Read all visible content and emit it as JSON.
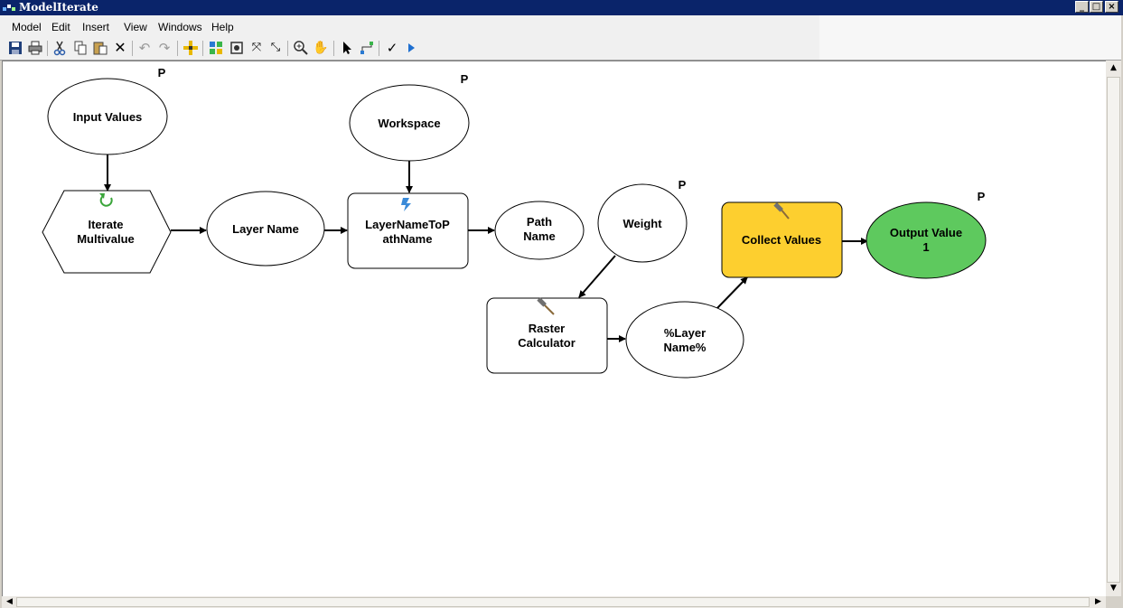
{
  "window": {
    "title": "ModelIterate",
    "controls": {
      "minimize": "_",
      "maximize": "□",
      "close": "×"
    }
  },
  "menu": [
    "Model",
    "Edit",
    "Insert",
    "View",
    "Windows",
    "Help"
  ],
  "toolbar": {
    "buttons": [
      "save-icon",
      "print-icon",
      "cut-icon",
      "copy-icon",
      "paste-icon",
      "delete-icon",
      "undo-icon",
      "redo-icon",
      "add-data-icon",
      "auto-layout-icon",
      "full-extent-icon",
      "zoom-in-fixed-icon",
      "zoom-out-fixed-icon",
      "zoom-icon",
      "pan-icon",
      "select-icon",
      "connect-icon",
      "validate-icon",
      "run-icon"
    ]
  },
  "colors": {
    "collect_values_fill": "#fdcf2f",
    "output_value_fill": "#5ec95e",
    "titlebar": "#0a246a",
    "node_border": "#000000"
  },
  "model": {
    "nodes": {
      "input_values": {
        "label": "Input Values",
        "param": "P"
      },
      "workspace": {
        "label": "Workspace",
        "param": "P"
      },
      "iterate_multivalue": {
        "line1": "Iterate",
        "line2": "Multivalue",
        "icon": "iterate-icon"
      },
      "layer_name": {
        "label": "Layer Name"
      },
      "layer_name_to_path": {
        "line1": "LayerNameToP",
        "line2": "athName",
        "icon": "script-tool-icon"
      },
      "path_name": {
        "line1": "Path",
        "line2": "Name"
      },
      "weight": {
        "label": "Weight",
        "param": "P"
      },
      "raster_calculator": {
        "line1": "Raster",
        "line2": "Calculator",
        "icon": "hammer-icon"
      },
      "layer_name_var": {
        "line1": "%Layer",
        "line2": "Name%"
      },
      "collect_values": {
        "label": "Collect Values",
        "icon": "hammer-icon"
      },
      "output_value": {
        "line1": "Output Value",
        "line2": "1",
        "param": "P"
      }
    }
  }
}
